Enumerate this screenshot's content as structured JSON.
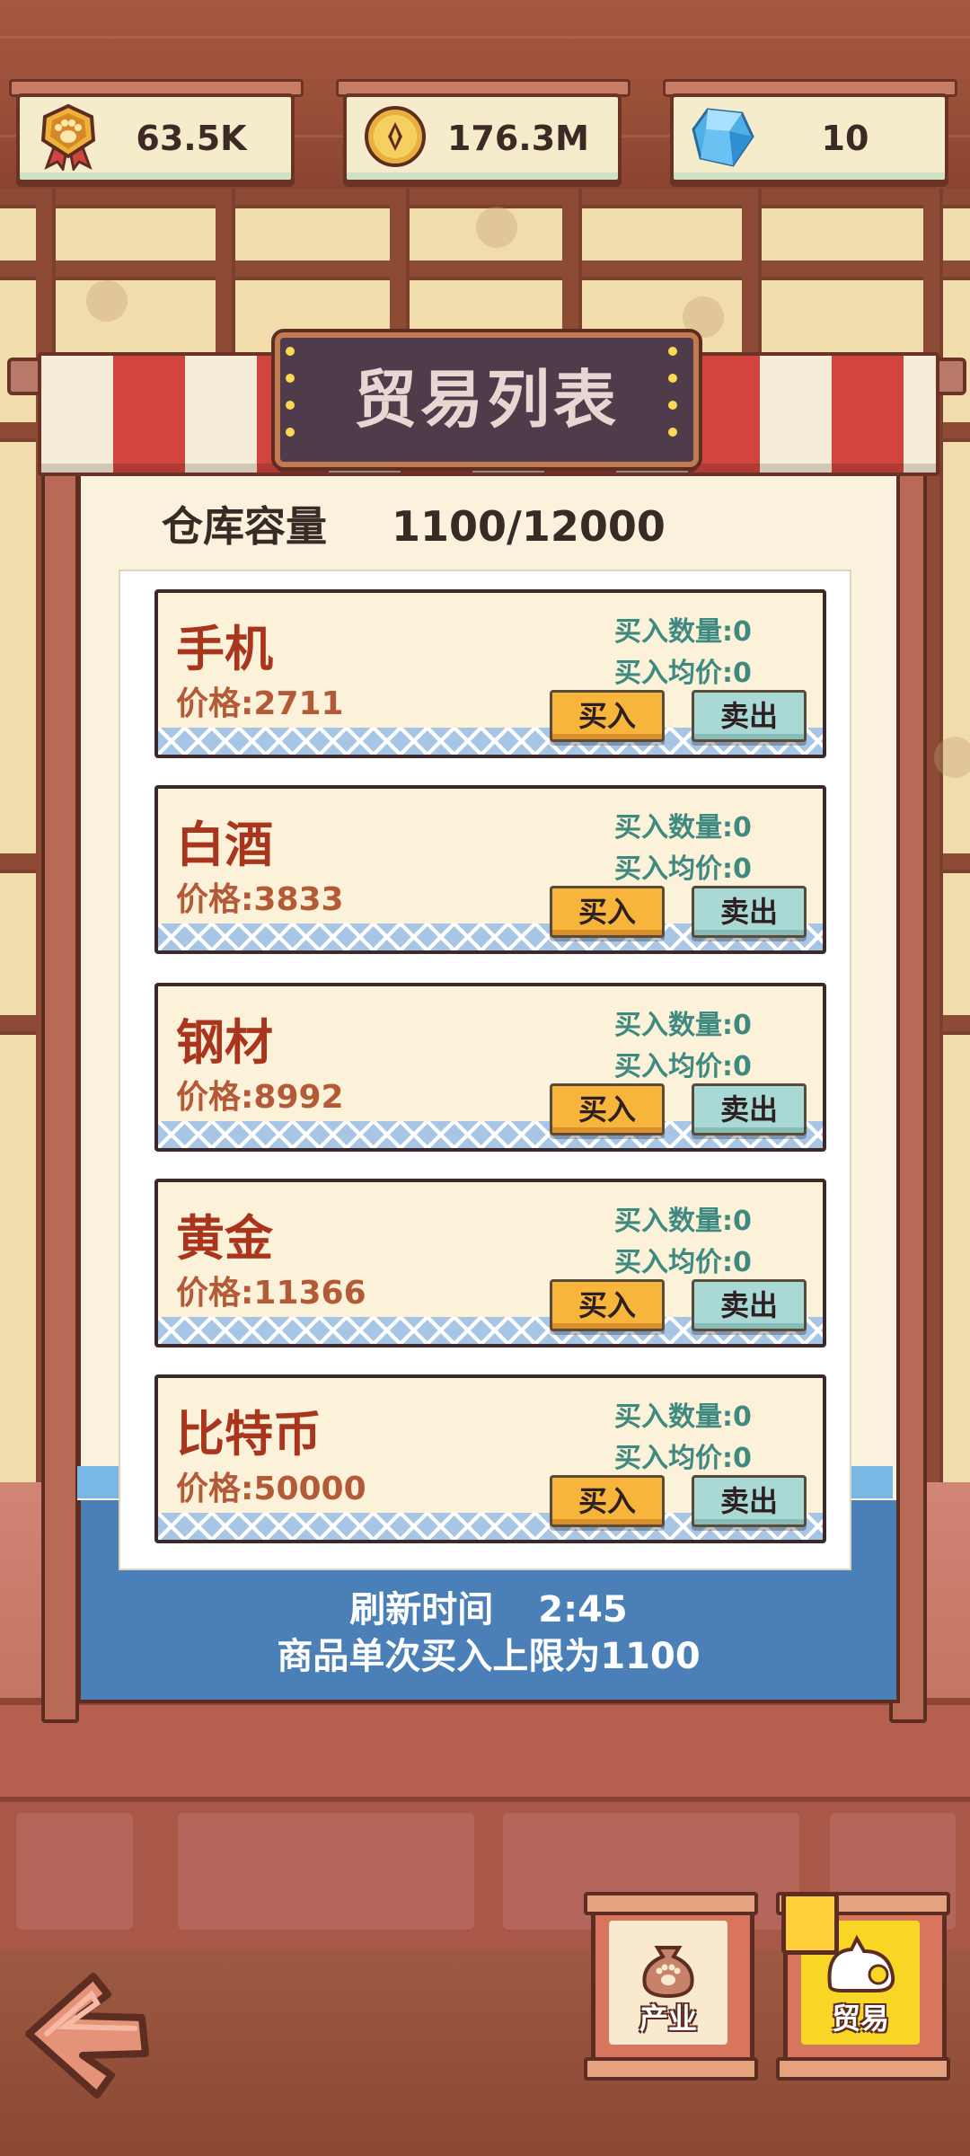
{
  "currencies": [
    {
      "id": "paw-medal",
      "icon": "paw-medal-icon",
      "value": "63.5K"
    },
    {
      "id": "coin",
      "icon": "coin-icon",
      "value": "176.3M"
    },
    {
      "id": "diamond",
      "icon": "diamond-icon",
      "value": "10"
    }
  ],
  "title": "贸易列表",
  "capacity": {
    "label": "仓库容量",
    "value": "1100/12000"
  },
  "items": [
    {
      "name": "手机",
      "price": "价格:2711",
      "qty": "买入数量:0",
      "avg": "买入均价:0",
      "buy": "买入",
      "sell": "卖出"
    },
    {
      "name": "白酒",
      "price": "价格:3833",
      "qty": "买入数量:0",
      "avg": "买入均价:0",
      "buy": "买入",
      "sell": "卖出"
    },
    {
      "name": "钢材",
      "price": "价格:8992",
      "qty": "买入数量:0",
      "avg": "买入均价:0",
      "buy": "买入",
      "sell": "卖出"
    },
    {
      "name": "黄金",
      "price": "价格:11366",
      "qty": "买入数量:0",
      "avg": "买入均价:0",
      "buy": "买入",
      "sell": "卖出"
    },
    {
      "name": "比特币",
      "price": "价格:50000",
      "qty": "买入数量:0",
      "avg": "买入均价:0",
      "buy": "买入",
      "sell": "卖出"
    }
  ],
  "footer": {
    "refresh_label": "刷新时间",
    "refresh_time": "2:45",
    "limit": "商品单次买入上限为1100"
  },
  "nav": {
    "industry": "产业",
    "trade": "贸易",
    "back_icon": "back-arrow-icon"
  },
  "colors": {
    "accent_yellow": "#f7b63b",
    "sell_teal": "#a8d9d5",
    "item_name": "#a9351d",
    "info_teal": "#3e8a80",
    "board_blue": "#4a7fb7"
  }
}
